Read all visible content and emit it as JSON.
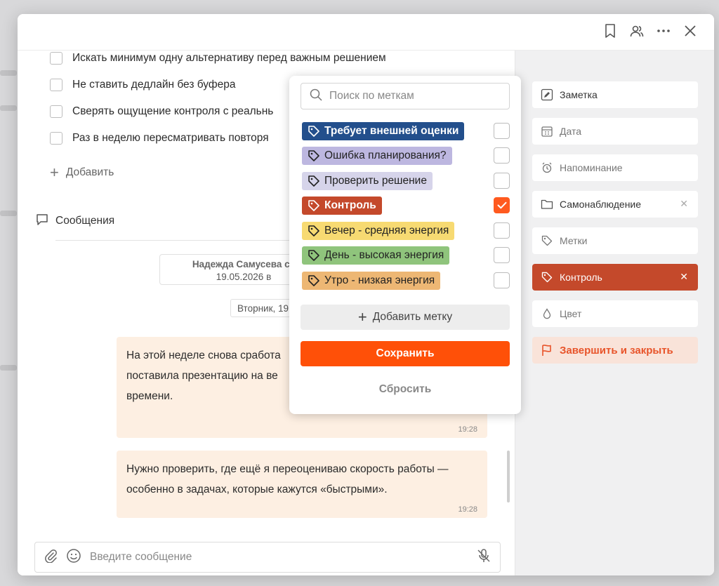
{
  "window": {
    "actions": [
      "bookmark-icon",
      "people-icon",
      "more-icon",
      "close-icon"
    ]
  },
  "checklist": {
    "items": [
      {
        "label": "Искать минимум одну альтернативу перед важным решением",
        "checked": false
      },
      {
        "label": "Не ставить дедлайн без буфера",
        "checked": false
      },
      {
        "label": "Сверять ощущение контроля с реальнь",
        "checked": false
      },
      {
        "label": "Раз в неделю пересматривать повторя",
        "checked": false
      }
    ],
    "add_label": "Добавить"
  },
  "messages": {
    "title": "Сообщения",
    "system_card": {
      "line1": "Надежда Самусева сс",
      "line2": "19.05.2026 в"
    },
    "date_chip": "Вторник, 19",
    "bubbles": [
      {
        "text": "На этой неделе снова сработа поставила презентацию на ве времени.",
        "time": "19:28"
      },
      {
        "text": "Нужно проверить, где ещё я переоцениваю скорость работы — особенно в задачах, которые кажутся «быстрыми».",
        "time": "19:28"
      }
    ],
    "composer_placeholder": "Введите сообщение"
  },
  "sidebar": {
    "items": [
      {
        "label": "Заметка",
        "icon": "pencil-icon"
      },
      {
        "label": "Дата",
        "icon": "calendar-icon"
      },
      {
        "label": "Напоминание",
        "icon": "alarm-icon"
      },
      {
        "label": "Самонаблюдение",
        "icon": "folder-icon",
        "removable": true
      },
      {
        "label": "Метки",
        "icon": "tag-icon"
      },
      {
        "label": "Контроль",
        "icon": "tag-icon",
        "removable": true,
        "color": "#c4492b"
      },
      {
        "label": "Цвет",
        "icon": "drop-icon"
      },
      {
        "label": "Завершить и закрыть",
        "icon": "flag-icon",
        "color": "#e8542a"
      }
    ]
  },
  "tag_popup": {
    "search_placeholder": "Поиск по меткам",
    "tags": [
      {
        "label": "Требует внешней оценки",
        "bg": "#234f8c",
        "fg": "#ffffff",
        "bold": true,
        "checked": false
      },
      {
        "label": "Ошибка планирования?",
        "bg": "#bdb7e0",
        "fg": "#222222",
        "bold": false,
        "checked": false
      },
      {
        "label": "Проверить решение",
        "bg": "#d6d4ea",
        "fg": "#222222",
        "bold": false,
        "checked": false
      },
      {
        "label": "Контроль",
        "bg": "#c4492b",
        "fg": "#ffffff",
        "bold": true,
        "checked": true
      },
      {
        "label": "Вечер - средняя энергия",
        "bg": "#f7da72",
        "fg": "#222222",
        "bold": false,
        "checked": false
      },
      {
        "label": "День - высокая энергия",
        "bg": "#8fc47c",
        "fg": "#222222",
        "bold": false,
        "checked": false
      },
      {
        "label": "Утро - низкая энергия",
        "bg": "#edb774",
        "fg": "#222222",
        "bold": false,
        "checked": false
      }
    ],
    "add_tag_label": "Добавить метку",
    "save_label": "Сохранить",
    "reset_label": "Сбросить"
  }
}
